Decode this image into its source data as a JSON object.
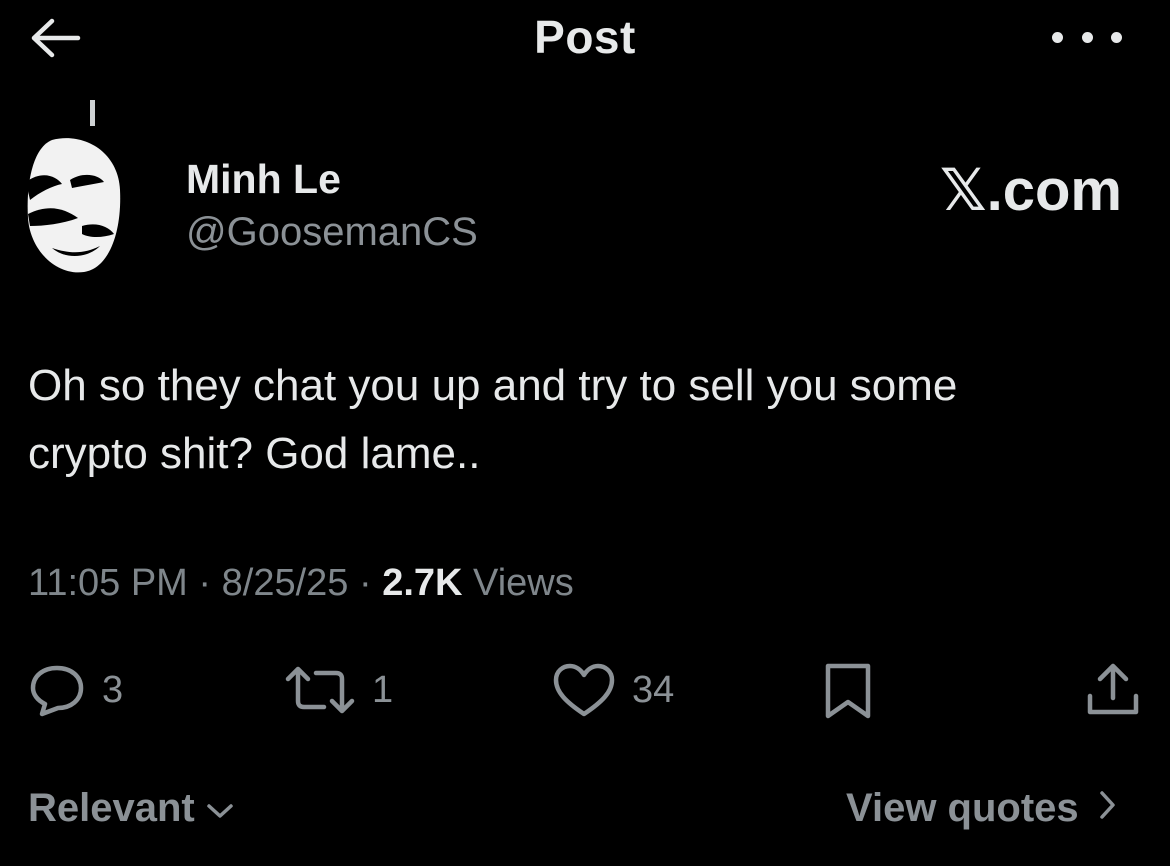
{
  "header": {
    "title": "Post",
    "back_icon": "arrow-left-icon",
    "more_icon": "more-horizontal-icon"
  },
  "author": {
    "name": "Minh Le",
    "handle": "@GoosemanCS",
    "avatar_icon": "avatar"
  },
  "watermark": "𝕏.com",
  "tweet": {
    "text_line_1": "Oh so they chat you up and try to sell you some",
    "text_line_2": "crypto shit? God lame.."
  },
  "meta": {
    "time": "11:05 PM",
    "separator": "·",
    "date": "8/25/25",
    "views_count": "2.7K",
    "views_label": "Views"
  },
  "actions": {
    "replies": "3",
    "reposts": "1",
    "likes": "34"
  },
  "footer": {
    "sort_label": "Relevant",
    "view_quotes_label": "View quotes"
  },
  "colors": {
    "background": "#000000",
    "primary_text": "#e7e9ea",
    "secondary_text": "#8b9196"
  }
}
